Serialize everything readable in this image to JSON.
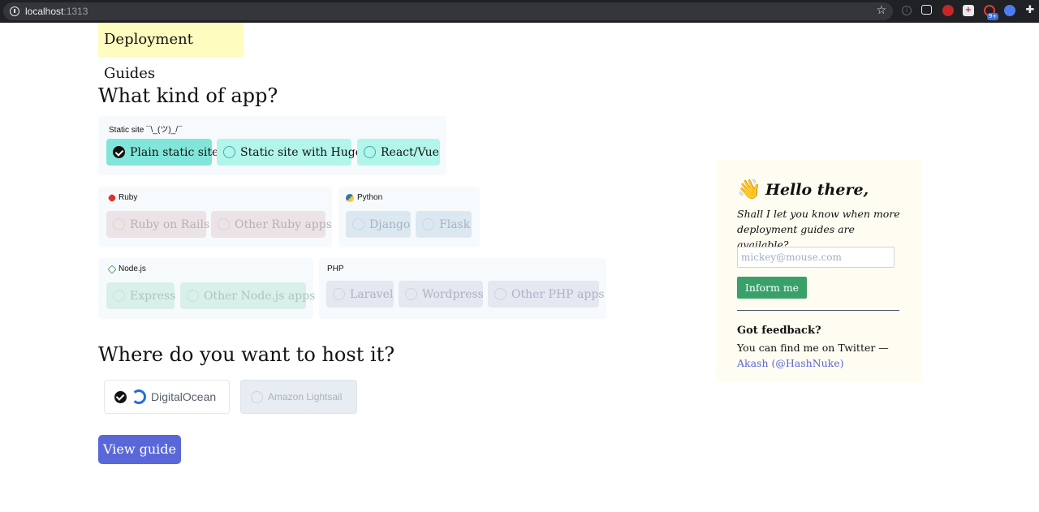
{
  "browser": {
    "url_host": "localhost",
    "url_port": ":1313",
    "extension_badge": "9+"
  },
  "page": {
    "badge_title": "Deployment Guides",
    "app_heading": "What kind of app?",
    "host_heading": "Where do you want to host it?",
    "view_button": "View guide"
  },
  "groups": {
    "static": {
      "label": "Static site ¯\\_(ツ)_/¯",
      "options": [
        "Plain static site",
        "Static site with Hugo",
        "React/Vue"
      ],
      "selected": "Plain static site"
    },
    "ruby": {
      "label": "Ruby",
      "icon": "ruby-gem-icon",
      "options": [
        "Ruby on Rails",
        "Other Ruby apps"
      ]
    },
    "python": {
      "label": "Python",
      "icon": "python-icon",
      "options": [
        "Django",
        "Flask"
      ]
    },
    "node": {
      "label": "Node.js",
      "icon": "nodejs-icon",
      "options": [
        "Express",
        "Other Node.js apps"
      ]
    },
    "php": {
      "label": "PHP",
      "options": [
        "Laravel",
        "Wordpress",
        "Other PHP apps"
      ]
    }
  },
  "hosts": {
    "digitalocean": "DigitalOcean",
    "lightsail": "Amazon Lightsail",
    "selected": "DigitalOcean"
  },
  "aside": {
    "wave_icon": "👋",
    "hello": "Hello there,",
    "text": "Shall I let you know when more deployment guides are available?",
    "email_placeholder": "mickey@mouse.com",
    "inform_button": "Inform me",
    "feedback_title": "Got feedback?",
    "feedback_text": "You can find me on Twitter —",
    "feedback_link": "Akash (@HashNuke)"
  },
  "colors": {
    "accent": "#5a67d8",
    "selected_option": "#81e6d9",
    "inform_button": "#38a169",
    "badge_background": "#fefcbf"
  }
}
